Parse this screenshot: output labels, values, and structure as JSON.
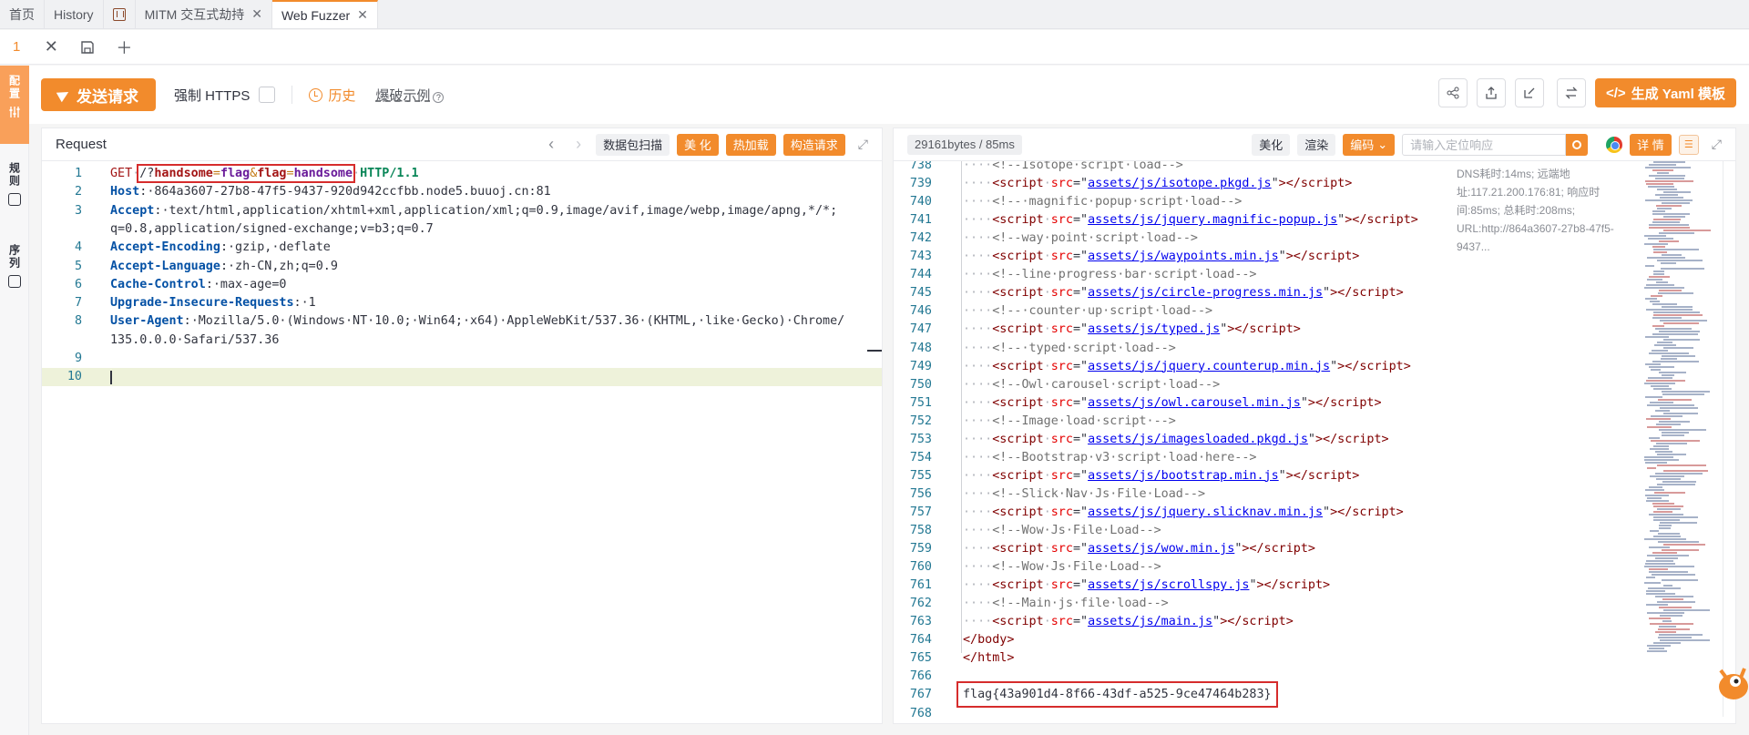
{
  "tabs": [
    {
      "label": "首页"
    },
    {
      "label": "History"
    },
    {
      "label": ""
    },
    {
      "label": "MITM 交互式劫持"
    },
    {
      "label": "Web Fuzzer"
    }
  ],
  "subtab": {
    "label": "1"
  },
  "sidebar": {
    "items": [
      {
        "label": "配置",
        "active": true
      },
      {
        "label": "规则",
        "active": false
      },
      {
        "label": "序列",
        "active": false
      }
    ]
  },
  "toolbar": {
    "send_label": "发送请求",
    "force_https_label": "强制 HTTPS",
    "history_label": "历史",
    "blast_label": "爆破示例",
    "yaml_label": "生成 Yaml 模板"
  },
  "request": {
    "title": "Request",
    "btn_scan": "数据包扫描",
    "btn_beautify": "美 化",
    "btn_hotload": "热加载",
    "btn_build": "构造请求",
    "lines": [
      {
        "n": "1",
        "method": "GET",
        "path_prefix": "/?",
        "p1": "handsome",
        "v1": "flag",
        "p2": "flag",
        "v2": "handsome",
        "proto": "HTTP/1.1"
      },
      {
        "n": "2",
        "key": "Host",
        "val": "864a3607-27b8-47f5-9437-920d942ccfbb.node5.buuoj.cn:81"
      },
      {
        "n": "3",
        "key": "Accept",
        "val": "text/html,application/xhtml+xml,application/xml;q=0.9,image/avif,image/webp,image/apng,*/*;",
        "cont": "q=0.8,application/signed-exchange;v=b3;q=0.7"
      },
      {
        "n": "4",
        "key": "Accept-Encoding",
        "val": "gzip, deflate"
      },
      {
        "n": "5",
        "key": "Accept-Language",
        "val": "zh-CN,zh;q=0.9"
      },
      {
        "n": "6",
        "key": "Cache-Control",
        "val": "max-age=0"
      },
      {
        "n": "7",
        "key": "Upgrade-Insecure-Requests",
        "val": "1"
      },
      {
        "n": "8",
        "key": "User-Agent",
        "val": "Mozilla/5.0 (Windows NT 10.0; Win64; x64) AppleWebKit/537.36 (KHTML, like Gecko) Chrome/",
        "cont": "135.0.0.0 Safari/537.36"
      },
      {
        "n": "9"
      },
      {
        "n": "10"
      }
    ]
  },
  "response": {
    "size": "29161bytes / 85ms",
    "btn_beautify": "美化",
    "btn_render": "渲染",
    "btn_encode": "编码",
    "search_placeholder": "请输入定位响应",
    "btn_detail": "详 情",
    "timing": "DNS耗时:14ms; 远端地址:117.21.200.176:81; 响应时间:85ms; 总耗时:208ms; URL:http://864a3607-27b8-47f5-9437...",
    "lines": [
      {
        "n": "738",
        "type": "comment",
        "text": "<!--Isotope script load-->"
      },
      {
        "n": "739",
        "type": "script",
        "src": "assets/js/isotope.pkgd.js"
      },
      {
        "n": "740",
        "type": "comment",
        "text": "<!-- magnific popup script load-->"
      },
      {
        "n": "741",
        "type": "script",
        "src": "assets/js/jquery.magnific-popup.js"
      },
      {
        "n": "742",
        "type": "comment",
        "text": "<!--way point script load-->"
      },
      {
        "n": "743",
        "type": "script",
        "src": "assets/js/waypoints.min.js"
      },
      {
        "n": "744",
        "type": "comment",
        "text": "<!--line progress bar script load-->"
      },
      {
        "n": "745",
        "type": "script",
        "src": "assets/js/circle-progress.min.js"
      },
      {
        "n": "746",
        "type": "comment",
        "text": "<!-- counter up script load-->"
      },
      {
        "n": "747",
        "type": "script",
        "src": "assets/js/typed.js"
      },
      {
        "n": "748",
        "type": "comment",
        "text": "<!-- typed script load-->"
      },
      {
        "n": "749",
        "type": "script",
        "src": "assets/js/jquery.counterup.min.js"
      },
      {
        "n": "750",
        "type": "comment",
        "text": "<!--Owl carousel script load-->"
      },
      {
        "n": "751",
        "type": "script",
        "src": "assets/js/owl.carousel.min.js"
      },
      {
        "n": "752",
        "type": "comment",
        "text": "<!--Image load script -->"
      },
      {
        "n": "753",
        "type": "script",
        "src": "assets/js/imagesloaded.pkgd.js"
      },
      {
        "n": "754",
        "type": "comment",
        "text": "<!--Bootstrap v3 script load here-->"
      },
      {
        "n": "755",
        "type": "script",
        "src": "assets/js/bootstrap.min.js"
      },
      {
        "n": "756",
        "type": "comment",
        "text": "<!--Slick Nav Js File Load-->"
      },
      {
        "n": "757",
        "type": "script",
        "src": "assets/js/jquery.slicknav.min.js"
      },
      {
        "n": "758",
        "type": "comment",
        "text": "<!--Wow Js File Load-->"
      },
      {
        "n": "759",
        "type": "script",
        "src": "assets/js/wow.min.js"
      },
      {
        "n": "760",
        "type": "comment",
        "text": "<!--Wow Js File Load-->"
      },
      {
        "n": "761",
        "type": "script",
        "src": "assets/js/scrollspy.js"
      },
      {
        "n": "762",
        "type": "comment",
        "text": "<!--Main js file load-->"
      },
      {
        "n": "763",
        "type": "script",
        "src": "assets/js/main.js"
      },
      {
        "n": "764",
        "type": "tag",
        "text": "</body>"
      },
      {
        "n": "765",
        "type": "tag",
        "text": "</html>"
      },
      {
        "n": "766",
        "type": "blank"
      },
      {
        "n": "767",
        "type": "flag",
        "text": "flag{43a901d4-8f66-43df-a525-9ce47464b283}"
      },
      {
        "n": "768",
        "type": "blank"
      }
    ]
  },
  "colors": {
    "accent": "#f28b2c",
    "highlight_box": "#d62c2c"
  }
}
